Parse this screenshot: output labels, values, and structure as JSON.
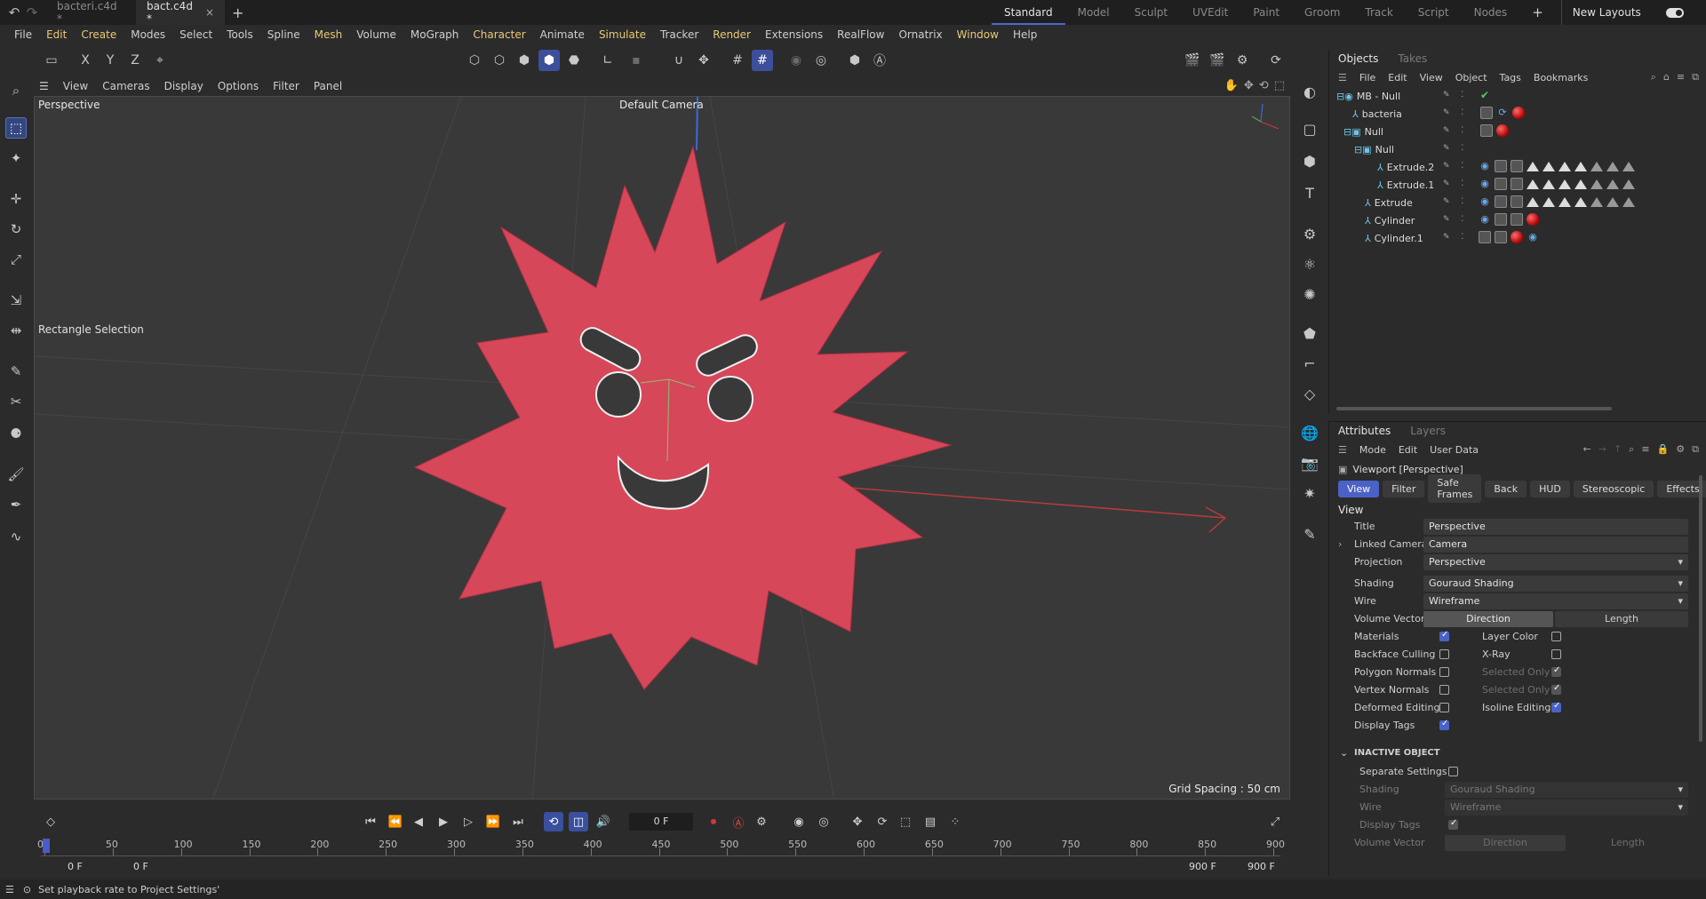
{
  "tabs": {
    "docs": [
      {
        "label": "bacteri.c4d *"
      },
      {
        "label": "bact.c4d *"
      }
    ],
    "layouts": [
      "Standard",
      "Model",
      "Sculpt",
      "UVEdit",
      "Paint",
      "Groom",
      "Track",
      "Script",
      "Nodes"
    ],
    "new_layouts": "New Layouts"
  },
  "menubar": [
    "File",
    "Edit",
    "Create",
    "Modes",
    "Select",
    "Tools",
    "Spline",
    "Mesh",
    "Volume",
    "MoGraph",
    "Character",
    "Animate",
    "Simulate",
    "Tracker",
    "Render",
    "Extensions",
    "RealFlow",
    "Ornatrix",
    "Window",
    "Help"
  ],
  "viewport": {
    "menu": [
      "View",
      "Cameras",
      "Display",
      "Options",
      "Filter",
      "Panel"
    ],
    "label": "Perspective",
    "camera": "Default Camera",
    "selection_tool": "Rectangle Selection",
    "grid_spacing": "Grid Spacing : 50 cm",
    "object_color": "#d6475a"
  },
  "timeline": {
    "current_frame": "0 F",
    "ticks": [
      "0",
      "50",
      "100",
      "150",
      "200",
      "250",
      "300",
      "350",
      "400",
      "450",
      "500",
      "550",
      "600",
      "650",
      "700",
      "750",
      "800",
      "850",
      "900"
    ],
    "range_start": "0 F",
    "range_start2": "0 F",
    "range_end": "900 F",
    "range_end2": "900 F"
  },
  "status": "Set playback rate to Project Settings'",
  "objects_panel": {
    "tabs": [
      "Objects",
      "Takes"
    ],
    "menu": [
      "File",
      "Edit",
      "View",
      "Object",
      "Tags",
      "Bookmarks"
    ],
    "items": [
      {
        "name": "MB - Null"
      },
      {
        "name": "bacteria"
      },
      {
        "name": "Null"
      },
      {
        "name": "Null"
      },
      {
        "name": "Extrude.2"
      },
      {
        "name": "Extrude.1"
      },
      {
        "name": "Extrude"
      },
      {
        "name": "Cylinder"
      },
      {
        "name": "Cylinder.1"
      }
    ]
  },
  "attributes": {
    "tabs": [
      "Attributes",
      "Layers"
    ],
    "menu": [
      "Mode",
      "Edit",
      "User Data"
    ],
    "title": "Viewport [Perspective]",
    "subtabs": [
      "View",
      "Filter",
      "Safe Frames",
      "Back",
      "HUD",
      "Stereoscopic",
      "Effects"
    ],
    "section": "View",
    "fields": {
      "title_label": "Title",
      "title_value": "Perspective",
      "linked_label": "Linked Camera",
      "linked_value": "Camera",
      "projection_label": "Projection",
      "projection_value": "Perspective",
      "shading_label": "Shading",
      "shading_value": "Gouraud Shading",
      "wire_label": "Wire",
      "wire_value": "Wireframe",
      "volume_label": "Volume Vector",
      "volume_a": "Direction",
      "volume_b": "Length"
    },
    "checks": {
      "materials": "Materials",
      "layer_color": "Layer Color",
      "backface": "Backface Culling",
      "xray": "X-Ray",
      "poly_normals": "Polygon Normals",
      "sel_only1": "Selected Only",
      "vert_normals": "Vertex Normals",
      "sel_only2": "Selected Only",
      "deformed": "Deformed Editing",
      "isoline": "Isoline Editing",
      "display_tags": "Display Tags"
    },
    "inactive": {
      "header": "INACTIVE OBJECT",
      "separate": "Separate Settings",
      "shading_label": "Shading",
      "shading_value": "Gouraud Shading",
      "wire_label": "Wire",
      "wire_value": "Wireframe",
      "tags_label": "Display Tags",
      "volume_label": "Volume Vector",
      "volume_a": "Direction",
      "volume_b": "Length"
    }
  }
}
